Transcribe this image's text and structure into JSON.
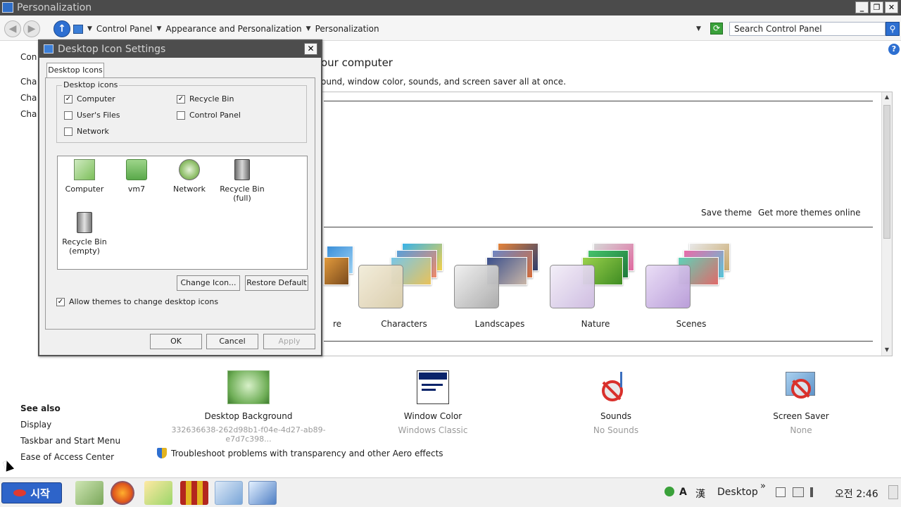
{
  "window": {
    "title": "Personalization",
    "minimize": "_",
    "maximize": "❐",
    "close": "✕"
  },
  "address": {
    "back": "◀",
    "forward": "▶",
    "up": "↑",
    "crumbs": [
      "Control Panel",
      "Appearance and Personalization",
      "Personalization"
    ],
    "search_placeholder": "Search Control Panel",
    "search_icon": "search-icon"
  },
  "left_pane": {
    "items": [
      "Con",
      "Cha",
      "Cha",
      "Cha"
    ]
  },
  "main": {
    "heading": "our computer",
    "subheading": "ound, window color, sounds, and screen saver all at once.",
    "save_theme": "Save theme",
    "more_themes": "Get more themes online",
    "themes": [
      {
        "name": "re"
      },
      {
        "name": "Characters"
      },
      {
        "name": "Landscapes"
      },
      {
        "name": "Nature"
      },
      {
        "name": "Scenes"
      }
    ]
  },
  "customizations": [
    {
      "name": "Desktop Background",
      "value": "332636638-262d98b1-f04e-4d27-ab89-e7d7c398..."
    },
    {
      "name": "Window Color",
      "value": "Windows Classic"
    },
    {
      "name": "Sounds",
      "value": "No Sounds"
    },
    {
      "name": "Screen Saver",
      "value": "None"
    }
  ],
  "see_also": {
    "title": "See also",
    "links": [
      "Display",
      "Taskbar and Start Menu",
      "Ease of Access Center"
    ]
  },
  "troubleshoot": "Troubleshoot problems with transparency and other Aero effects",
  "dialog": {
    "title": "Desktop Icon Settings",
    "close": "✕",
    "tab": "Desktop Icons",
    "group_label": "Desktop icons",
    "checkboxes": [
      {
        "label": "Computer",
        "checked": true,
        "mark": "✓"
      },
      {
        "label": "Recycle Bin",
        "checked": true,
        "mark": "✓"
      },
      {
        "label": "User's Files",
        "checked": false,
        "mark": ""
      },
      {
        "label": "Control Panel",
        "checked": false,
        "mark": ""
      },
      {
        "label": "Network",
        "checked": false,
        "mark": ""
      }
    ],
    "icons": [
      {
        "label": "Computer"
      },
      {
        "label": "vm7"
      },
      {
        "label": "Network"
      },
      {
        "label": "Recycle Bin",
        "label2": "(full)"
      },
      {
        "label": "Recycle Bin",
        "label2": "(empty)"
      }
    ],
    "change_icon": "Change Icon...",
    "restore_default": "Restore Default",
    "allow_themes": {
      "label": "Allow themes to change desktop icons",
      "checked": true,
      "mark": "✓"
    },
    "ok": "OK",
    "cancel": "Cancel",
    "apply": "Apply"
  },
  "taskbar": {
    "start": "시작",
    "ime_a": "A",
    "ime_han": "漢",
    "desktop": "Desktop",
    "chevron": "»",
    "clock": "오전 2:46"
  }
}
